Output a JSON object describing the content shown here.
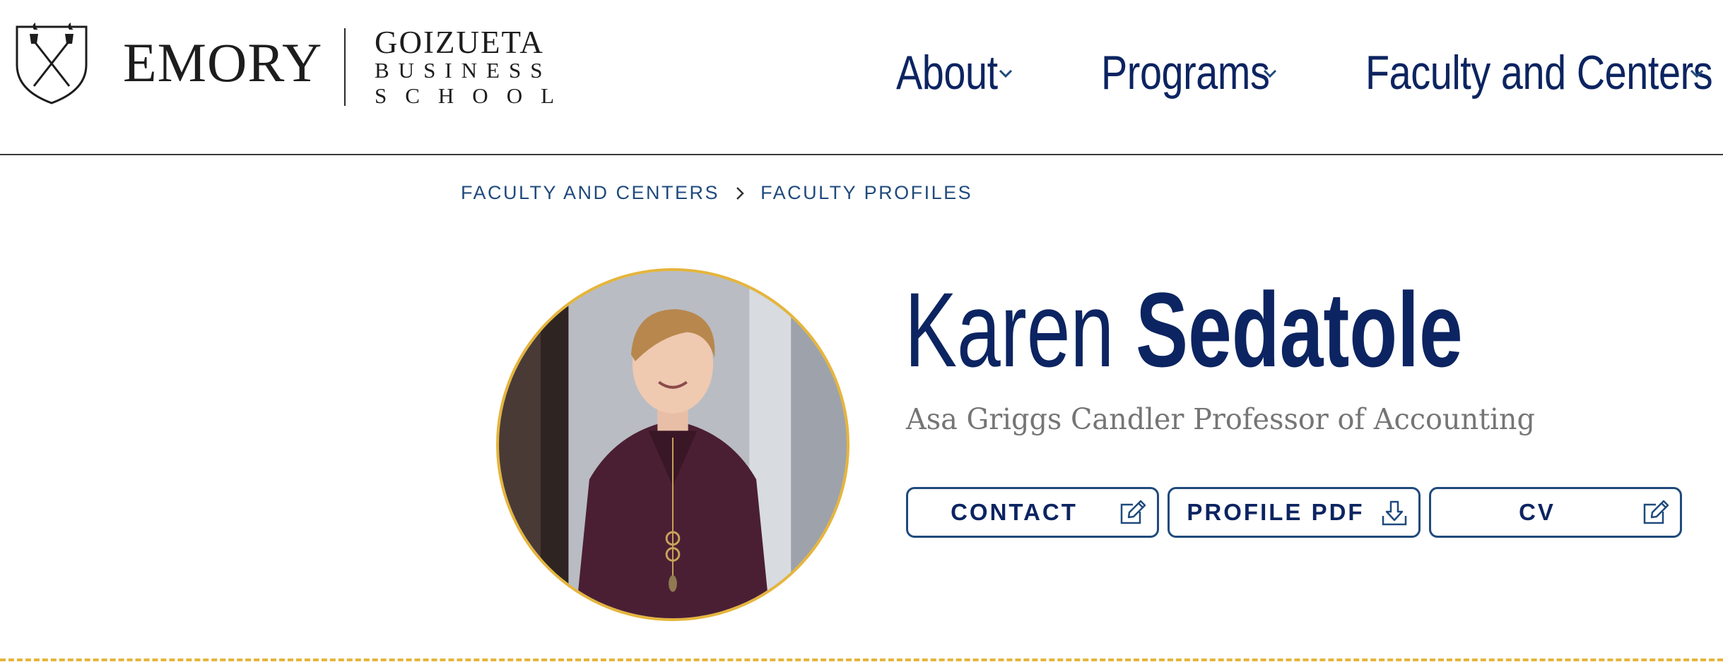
{
  "header": {
    "logo": {
      "university": "EMORY",
      "school_line1": "GOIZUETA",
      "school_line2": "BUSINESS",
      "school_line3": "SCHOOL",
      "shield_icon": "emory-shield-torch-icon"
    },
    "nav": [
      {
        "label": "About",
        "icon": "chevron-down-icon"
      },
      {
        "label": "Programs",
        "icon": "chevron-down-icon"
      },
      {
        "label": "Faculty and Centers",
        "icon": "chevron-down-icon"
      }
    ]
  },
  "breadcrumb": {
    "items": [
      "FACULTY AND CENTERS",
      "FACULTY PROFILES"
    ],
    "separator_icon": "chevron-right-icon"
  },
  "profile": {
    "first_name": "Karen",
    "last_name": "Sedatole",
    "title": "Asa Griggs Candler Professor of Accounting",
    "photo": "portrait-photo",
    "actions": [
      {
        "label": "CONTACT",
        "icon": "edit-icon"
      },
      {
        "label": "PROFILE PDF",
        "icon": "download-icon"
      },
      {
        "label": "CV",
        "icon": "edit-icon"
      }
    ]
  },
  "colors": {
    "navy": "#0c2461",
    "link_blue": "#1f4a7c",
    "gold": "#e5b53c",
    "title_gray": "#757575"
  }
}
